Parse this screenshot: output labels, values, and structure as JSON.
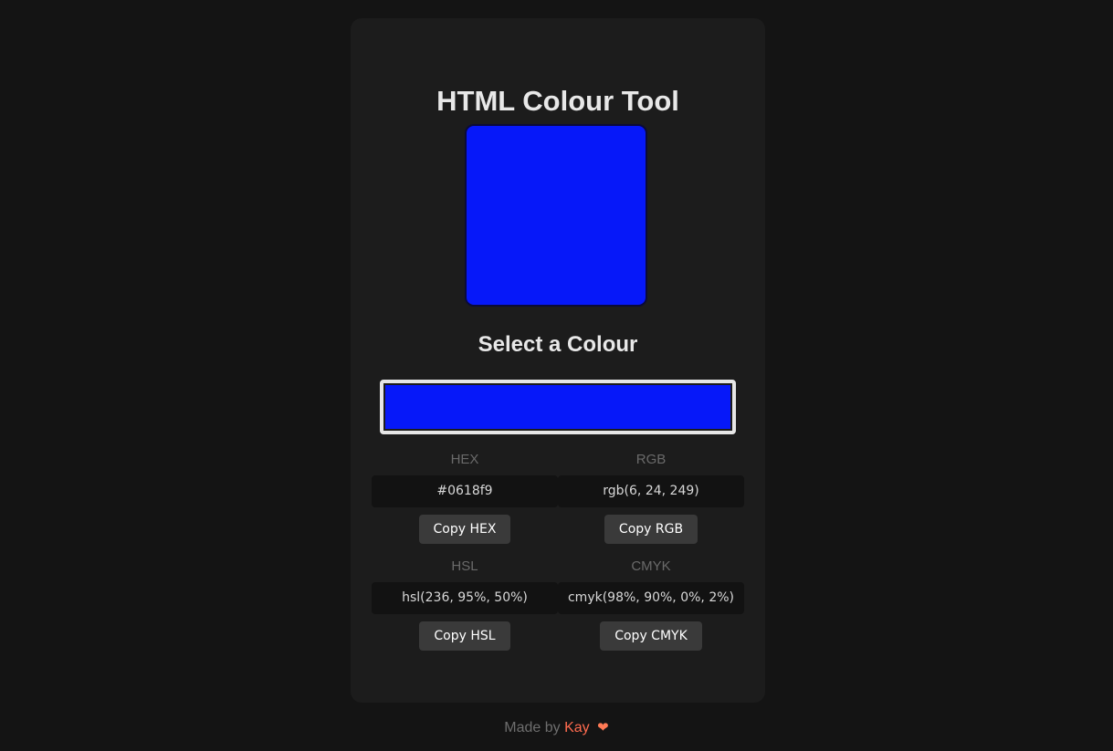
{
  "app": {
    "title": "HTML Colour Tool",
    "subtitle": "Select a Colour"
  },
  "colour": {
    "current_hex": "#0618f9",
    "preview_border_color": "#0a0a3a"
  },
  "formats": [
    {
      "label": "HEX",
      "value": "#0618f9",
      "button": "Copy HEX"
    },
    {
      "label": "RGB",
      "value": "rgb(6, 24, 249)",
      "button": "Copy RGB"
    },
    {
      "label": "HSL",
      "value": "hsl(236, 95%, 50%)",
      "button": "Copy HSL"
    },
    {
      "label": "CMYK",
      "value": "cmyk(98%, 90%, 0%, 2%)",
      "button": "Copy CMYK"
    }
  ],
  "footer": {
    "prefix": "Made by",
    "author": "Kay",
    "heart_icon": "heart-icon",
    "author_color": "#ff6b4f"
  },
  "theme": {
    "background": "#141414",
    "card": "#1c1c1c",
    "value_bg": "#121212",
    "button_bg": "#3a3a3a"
  }
}
